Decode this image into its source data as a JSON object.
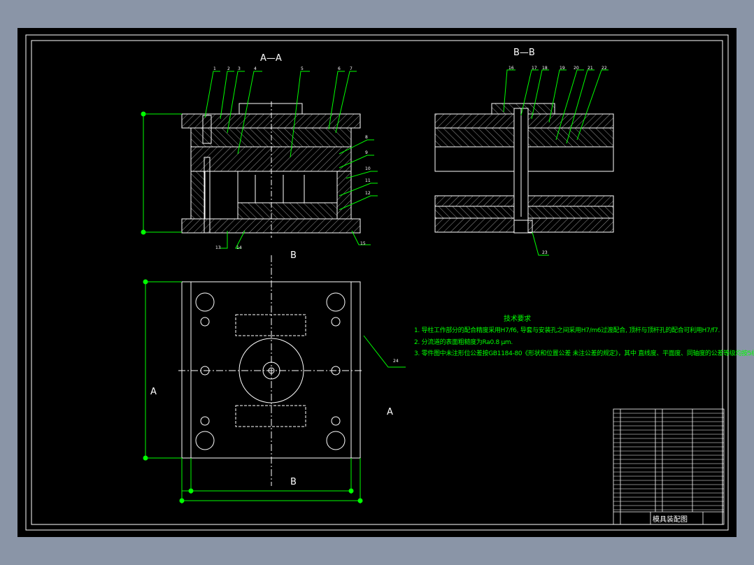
{
  "views": {
    "section_aa": "A—A",
    "section_bb": "B—B",
    "cut_b_top": "B",
    "cut_b_bottom": "B",
    "cut_a_left": "A",
    "cut_a_right": "A"
  },
  "part_labels_aa": [
    "1",
    "2",
    "3",
    "4",
    "5",
    "6",
    "7",
    "8",
    "9",
    "10",
    "11",
    "12",
    "13",
    "14",
    "15"
  ],
  "part_labels_bb": [
    "16",
    "17",
    "18",
    "19",
    "20",
    "21",
    "22",
    "23"
  ],
  "part_label_plan": "24",
  "technical_requirements": {
    "title": "技术要求",
    "items": [
      "1. 导柱工作部分的配合精度采用H7/f6, 导套与安装孔之间采用H7/m6过渡配合, 顶杆与顶杆孔的配合可利用H7/f7.",
      "2. 分流道的表面粗糙度为Ra0.8 μm.",
      "3. 零件图中未注形位公差按GB1184-80《形状和位置公差 未注公差的规定》，其中 直线度、平面度、同轴度的公差等级均按5级."
    ]
  },
  "title_block": {
    "drawing_title": "模具装配图"
  },
  "colors": {
    "background": "#000000",
    "geometry": "#ffffff",
    "annotation": "#00ff00",
    "window": "#8a95a7"
  }
}
